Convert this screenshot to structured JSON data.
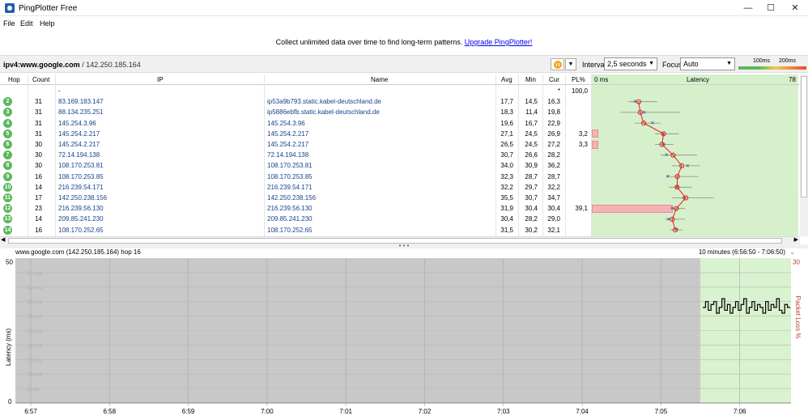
{
  "window": {
    "title": "PingPlotter Free",
    "minimize": "—",
    "maximize": "☐",
    "close": "✕",
    "icon": "pingplotter-app-icon"
  },
  "menu": [
    "File",
    "Edit",
    "Help"
  ],
  "banner": {
    "text": "Collect unlimited data over time to find long-term patterns.",
    "link": "Upgrade PingPlotter!"
  },
  "target": {
    "name": "ipv4:www.google.com",
    "ip": " / 142.250.185.164",
    "interval_label": "Interval",
    "interval_value": "2,5 seconds",
    "focus_label": "Focus",
    "focus_value": "Auto",
    "scale_low": "100ms",
    "scale_high": "200ms"
  },
  "table": {
    "headers": {
      "hop": "Hop",
      "count": "Count",
      "ip": "IP",
      "name": "Name",
      "avg": "Avg",
      "min": "Min",
      "cur": "Cur",
      "pl": "PL%",
      "lat_zero": "0 ms",
      "latency": "Latency",
      "lat_max": "78"
    },
    "rows": [
      {
        "hop": "",
        "count": "",
        "ip": "-",
        "name": "",
        "avg": "",
        "min": "",
        "cur": "*",
        "pl": "100,0"
      },
      {
        "hop": "2",
        "count": "31",
        "ip": "83.169.183.147",
        "name": "ip53a9b793.static.kabel-deutschland.de",
        "avg": "17,7",
        "min": "14,5",
        "cur": "16,3",
        "pl": ""
      },
      {
        "hop": "3",
        "count": "31",
        "ip": "88.134.235.251",
        "name": "ip5886ebfb.static.kabel-deutschland.de",
        "avg": "18,3",
        "min": "11,4",
        "cur": "19,8",
        "pl": ""
      },
      {
        "hop": "4",
        "count": "31",
        "ip": "145.254.3.96",
        "name": "145.254.3.96",
        "avg": "19,6",
        "min": "16,7",
        "cur": "22,9",
        "pl": ""
      },
      {
        "hop": "5",
        "count": "31",
        "ip": "145.254.2.217",
        "name": "145.254.2.217",
        "avg": "27,1",
        "min": "24,5",
        "cur": "26,9",
        "pl": "3,2"
      },
      {
        "hop": "6",
        "count": "30",
        "ip": "145.254.2.217",
        "name": "145.254.2.217",
        "avg": "26,5",
        "min": "24,5",
        "cur": "27,2",
        "pl": "3,3"
      },
      {
        "hop": "7",
        "count": "30",
        "ip": "72.14.194.138",
        "name": "72.14.194.138",
        "avg": "30,7",
        "min": "26,6",
        "cur": "28,2",
        "pl": ""
      },
      {
        "hop": "8",
        "count": "30",
        "ip": "108.170.253.81",
        "name": "108.170.253.81",
        "avg": "34,0",
        "min": "30,9",
        "cur": "36,2",
        "pl": ""
      },
      {
        "hop": "9",
        "count": "16",
        "ip": "108.170.253.85",
        "name": "108.170.253.85",
        "avg": "32,3",
        "min": "28,7",
        "cur": "28,7",
        "pl": ""
      },
      {
        "hop": "10",
        "count": "14",
        "ip": "216.239.54.171",
        "name": "216.239.54.171",
        "avg": "32,2",
        "min": "29,7",
        "cur": "32,2",
        "pl": ""
      },
      {
        "hop": "11",
        "count": "17",
        "ip": "142.250.238.156",
        "name": "142.250.238.156",
        "avg": "35,5",
        "min": "30,7",
        "cur": "34,7",
        "pl": ""
      },
      {
        "hop": "12",
        "count": "23",
        "ip": "216.239.56.130",
        "name": "216.239.56.130",
        "avg": "31,9",
        "min": "30,4",
        "cur": "30,4",
        "pl": "39,1"
      },
      {
        "hop": "13",
        "count": "14",
        "ip": "209.85.241.230",
        "name": "209.85.241.230",
        "avg": "30,4",
        "min": "28,2",
        "cur": "29,0",
        "pl": ""
      },
      {
        "hop": "14",
        "count": "16",
        "ip": "108.170.252.65",
        "name": "108.170.252.65",
        "avg": "31,5",
        "min": "30,2",
        "cur": "32,1",
        "pl": ""
      }
    ],
    "latency_max_ms": 78,
    "pl_max_percent": 100
  },
  "graph": {
    "title": "www.google.com (142.250.185.164) hop 16",
    "range": "10 minutes (6:56:50 - 7:06:50)",
    "ylabel": "Latency (ms)",
    "y2label": "Packet Loss %",
    "y_top": "50",
    "y_zero": "0",
    "y2_top": "30",
    "faint_ticks": [
      "45 ms",
      "40 ms",
      "35 ms",
      "30 ms",
      "25 ms",
      "20 ms",
      "15 ms",
      "10 ms",
      "5 ms"
    ],
    "x_ticks": [
      "6:57",
      "6:58",
      "6:59",
      "7:00",
      "7:01",
      "7:02",
      "7:03",
      "7:04",
      "7:05",
      "7:06"
    ]
  },
  "chart_data": {
    "type": "line",
    "title": "www.google.com (142.250.185.164) hop 16",
    "xlabel": "",
    "ylabel": "Latency (ms)",
    "ylim": [
      0,
      50
    ],
    "y2lim": [
      0,
      30
    ],
    "no_data_until": "7:05:30",
    "series": [
      {
        "values": [
          33,
          35,
          32,
          34,
          35,
          31,
          33,
          36,
          32,
          34,
          31,
          33,
          35,
          32,
          34,
          36,
          31,
          33,
          35,
          32,
          34,
          33,
          31,
          35,
          32,
          34,
          33,
          36,
          32,
          31,
          34,
          33
        ]
      }
    ]
  }
}
